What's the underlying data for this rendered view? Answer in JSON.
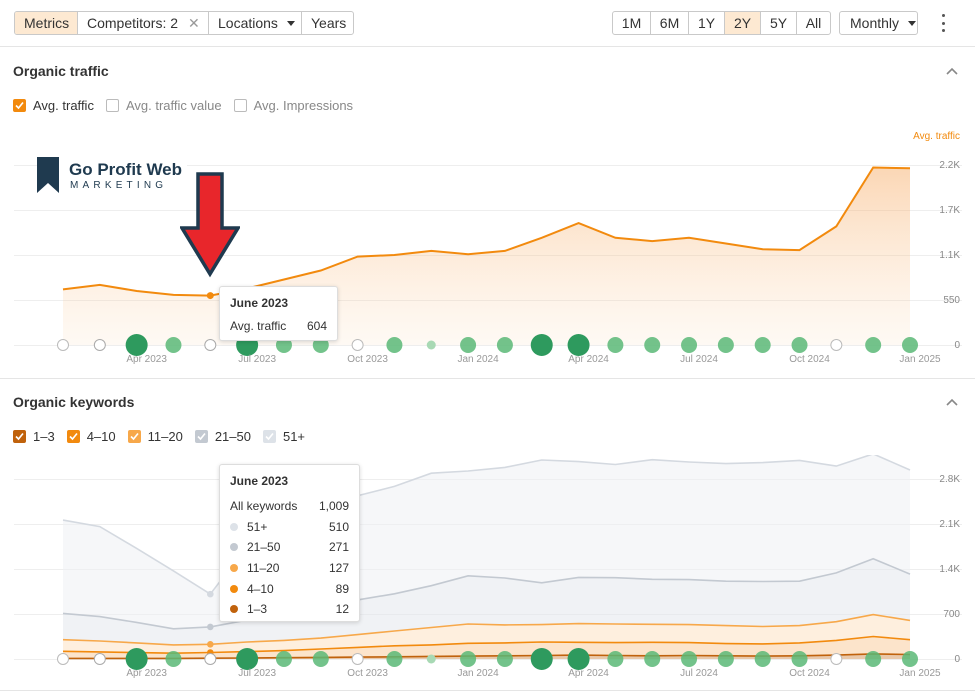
{
  "toolbar": {
    "left_tabs": [
      {
        "label": "Metrics",
        "active": true
      },
      {
        "label": "Competitors: 2",
        "active": false
      },
      {
        "label": "Locations",
        "active": false
      },
      {
        "label": "Years",
        "active": false
      }
    ],
    "ranges": [
      "1M",
      "6M",
      "1Y",
      "2Y",
      "5Y",
      "All"
    ],
    "active_range": "2Y",
    "granularity": "Monthly"
  },
  "traffic": {
    "title": "Organic traffic",
    "legend": [
      {
        "label": "Avg. traffic",
        "checked": true
      },
      {
        "label": "Avg. traffic value",
        "checked": false
      },
      {
        "label": "Avg. Impressions",
        "checked": false
      }
    ],
    "axis_title": "Avg. traffic",
    "tooltip": {
      "title": "June 2023",
      "label": "Avg. traffic",
      "value": "604"
    }
  },
  "keywords": {
    "title": "Organic keywords",
    "legend": [
      {
        "label": "1–3",
        "checked": true,
        "color": "#c0620c"
      },
      {
        "label": "4–10",
        "checked": true,
        "color": "#f28a0e"
      },
      {
        "label": "11–20",
        "checked": true,
        "color": "#f7a84a"
      },
      {
        "label": "21–50",
        "checked": true,
        "color": "#c3c9d1"
      },
      {
        "label": "51+",
        "checked": true,
        "color": "#dde2e8"
      }
    ],
    "tooltip": {
      "title": "June 2023",
      "rows": [
        {
          "label": "All keywords",
          "value": "1,009",
          "color": ""
        },
        {
          "label": "51+",
          "value": "510",
          "color": "#dde2e8"
        },
        {
          "label": "21–50",
          "value": "271",
          "color": "#c3c9d1"
        },
        {
          "label": "11–20",
          "value": "127",
          "color": "#f7a84a"
        },
        {
          "label": "4–10",
          "value": "89",
          "color": "#f28a0e"
        },
        {
          "label": "1–3",
          "value": "12",
          "color": "#c0620c"
        }
      ]
    }
  },
  "logo": {
    "line1": "Go Profit Web",
    "line2": "MARKETING"
  },
  "colors": {
    "accent": "#f28a0e",
    "accent_bg": "#fde9d2",
    "arrow": "#e8262b",
    "marker_green": "#3aa56a"
  },
  "chart_data": [
    {
      "type": "area",
      "title": "Organic traffic",
      "ylabel": "Avg. traffic",
      "x_tick_labels": [
        "Apr 2023",
        "Jul 2023",
        "Oct 2023",
        "Jan 2024",
        "Apr 2024",
        "Jul 2024",
        "Oct 2024",
        "Jan 2025"
      ],
      "y_tick_labels": [
        "2.2K",
        "1.7K",
        "1.1K",
        "550",
        "0"
      ],
      "ylim": [
        0,
        2200
      ],
      "x": [
        "Feb 2023",
        "Mar 2023",
        "Apr 2023",
        "May 2023",
        "Jun 2023",
        "Jul 2023",
        "Aug 2023",
        "Sep 2023",
        "Oct 2023",
        "Nov 2023",
        "Dec 2023",
        "Jan 2024",
        "Feb 2024",
        "Mar 2024",
        "Apr 2024",
        "May 2024",
        "Jun 2024",
        "Jul 2024",
        "Aug 2024",
        "Sep 2024",
        "Oct 2024",
        "Nov 2024",
        "Dec 2024",
        "Jan 2025"
      ],
      "series": [
        {
          "name": "Avg. traffic",
          "values": [
            680,
            735,
            660,
            612,
            604,
            690,
            800,
            910,
            1080,
            1100,
            1150,
            1110,
            1150,
            1310,
            1490,
            1310,
            1270,
            1310,
            1240,
            1170,
            1160,
            1450,
            2170,
            2160
          ]
        }
      ]
    },
    {
      "type": "area",
      "title": "Organic keywords",
      "x_tick_labels": [
        "Apr 2023",
        "Jul 2023",
        "Oct 2023",
        "Jan 2024",
        "Apr 2024",
        "Jul 2024",
        "Oct 2024",
        "Jan 2025"
      ],
      "y_tick_labels": [
        "2.8K",
        "2.1K",
        "1.4K",
        "700",
        "0"
      ],
      "ylim": [
        0,
        2800
      ],
      "x": [
        "Feb 2023",
        "Mar 2023",
        "Apr 2023",
        "May 2023",
        "Jun 2023",
        "Jul 2023",
        "Aug 2023",
        "Sep 2023",
        "Oct 2023",
        "Nov 2023",
        "Dec 2023",
        "Jan 2024",
        "Feb 2024",
        "Mar 2024",
        "Apr 2024",
        "May 2024",
        "Jun 2024",
        "Jul 2024",
        "Aug 2024",
        "Sep 2024",
        "Oct 2024",
        "Nov 2024",
        "Dec 2024",
        "Jan 2025"
      ],
      "stacked": true,
      "series": [
        {
          "name": "1–3",
          "values": [
            10,
            10,
            10,
            10,
            12,
            15,
            20,
            25,
            30,
            35,
            40,
            45,
            50,
            55,
            60,
            55,
            50,
            55,
            50,
            45,
            50,
            60,
            80,
            70
          ]
        },
        {
          "name": "4–10",
          "values": [
            110,
            100,
            90,
            80,
            89,
            100,
            110,
            130,
            150,
            170,
            180,
            200,
            200,
            210,
            200,
            200,
            210,
            200,
            190,
            190,
            200,
            230,
            270,
            230
          ]
        },
        {
          "name": "11–20",
          "values": [
            180,
            170,
            150,
            130,
            127,
            150,
            160,
            170,
            200,
            230,
            270,
            300,
            280,
            270,
            290,
            290,
            280,
            280,
            280,
            270,
            270,
            290,
            340,
            300
          ]
        },
        {
          "name": "21–50",
          "values": [
            410,
            380,
            320,
            250,
            271,
            340,
            360,
            440,
            540,
            580,
            650,
            750,
            730,
            650,
            720,
            720,
            700,
            700,
            690,
            700,
            690,
            760,
            870,
            720
          ]
        },
        {
          "name": "51+",
          "values": [
            1450,
            1400,
            1150,
            900,
            510,
            1150,
            1300,
            1480,
            1620,
            1670,
            1750,
            1630,
            1720,
            1910,
            1800,
            1760,
            1860,
            1830,
            1830,
            1850,
            1880,
            1660,
            1630,
            1620
          ]
        }
      ]
    }
  ]
}
